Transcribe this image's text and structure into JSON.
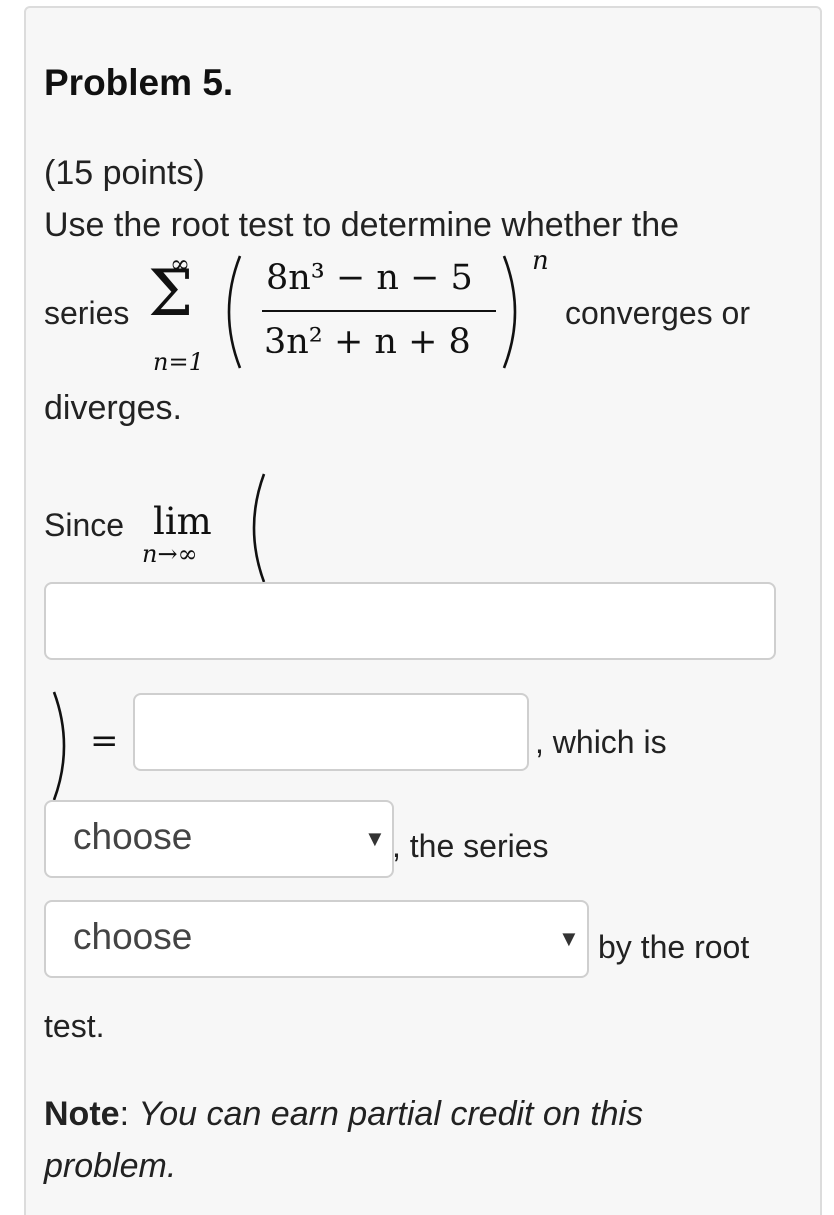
{
  "problem": {
    "title": "Problem 5.",
    "points": "(15 points)",
    "intro_line1": "Use the root test to determine whether the",
    "series_word": "series",
    "converges_or": "converges or",
    "diverges": "diverges.",
    "math": {
      "sum_upper": "∞",
      "sum_lower": "n=1",
      "sigma": "Σ",
      "numerator": "8n³ − n − 5",
      "denominator": "3n² + n + 8",
      "exponent": "n",
      "lim": "lim",
      "lim_sub": "n→∞",
      "equals": "="
    }
  },
  "answer": {
    "since_label": "Since",
    "which_is": ", which is",
    "the_series": ", the series",
    "by_the_root": "by the root",
    "test": "test.",
    "limit_input_value": "",
    "result_input_value": "",
    "select1_value": "choose",
    "select2_value": "choose",
    "arrow_icon": "▼"
  },
  "note": {
    "label": "Note",
    "colon": ":",
    "text_line1": "You can earn partial credit on this",
    "text_line2": "problem."
  }
}
